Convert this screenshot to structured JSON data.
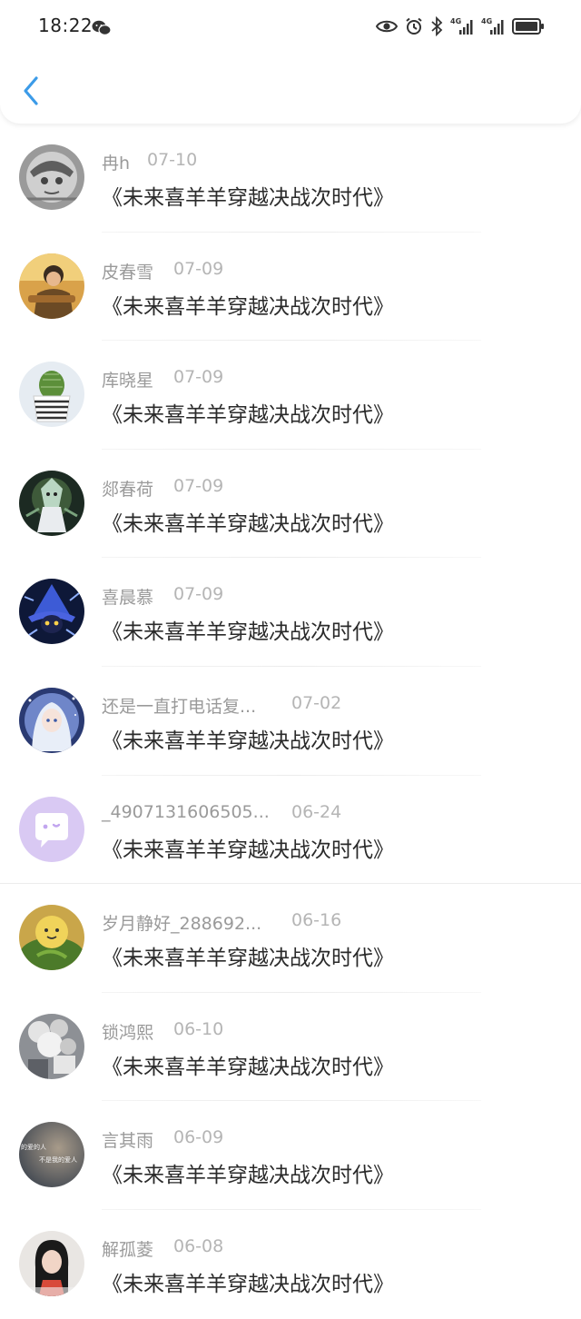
{
  "status_bar": {
    "time": "18:22",
    "icons": [
      "wechat-icon",
      "eye-icon",
      "alarm-icon",
      "bluetooth-icon",
      "signal-4g-icon",
      "signal-4g-icon",
      "battery-icon"
    ],
    "network_label_1": "4G",
    "network_label_2": "4G"
  },
  "header": {
    "back_icon": "chevron-left-icon"
  },
  "list": {
    "items": [
      {
        "name": "冉h",
        "date": "07-10",
        "title": "《未来喜羊羊穿越决战次时代》"
      },
      {
        "name": "皮春雪",
        "date": "07-09",
        "title": "《未来喜羊羊穿越决战次时代》"
      },
      {
        "name": "库晓星",
        "date": "07-09",
        "title": "《未来喜羊羊穿越决战次时代》"
      },
      {
        "name": "郯春荷",
        "date": "07-09",
        "title": "《未来喜羊羊穿越决战次时代》"
      },
      {
        "name": "喜晨慕",
        "date": "07-09",
        "title": "《未来喜羊羊穿越决战次时代》"
      },
      {
        "name": "还是一直打电话复...",
        "date": "07-02",
        "title": "《未来喜羊羊穿越决战次时代》"
      },
      {
        "name": "_4907131606505...",
        "date": "06-24",
        "title": "《未来喜羊羊穿越决战次时代》"
      },
      {
        "name": "岁月静好_288692...",
        "date": "06-16",
        "title": "《未来喜羊羊穿越决战次时代》"
      },
      {
        "name": "锁鸿熙",
        "date": "06-10",
        "title": "《未来喜羊羊穿越决战次时代》"
      },
      {
        "name": "言其雨",
        "date": "06-09",
        "title": "《未来喜羊羊穿越决战次时代》"
      },
      {
        "name": "解孤菱",
        "date": "06-08",
        "title": "《未来喜羊羊穿越决战次时代》"
      }
    ],
    "avatar_10_text_1": "的爱的人",
    "avatar_10_text_2": "不是我的爱人"
  },
  "colors": {
    "accent": "#3c9be8",
    "name_gray": "#9a9a9a",
    "date_gray": "#b5b5b5",
    "title_text": "#2a2a2a",
    "default_avatar": "#d9c9f3"
  }
}
